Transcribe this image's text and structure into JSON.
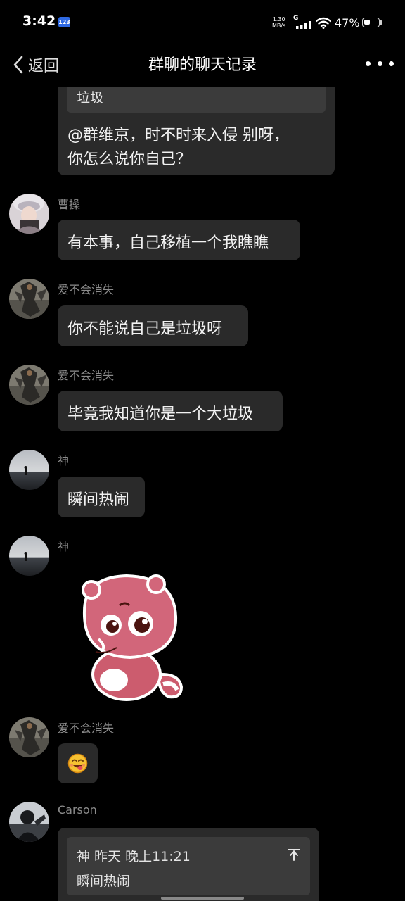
{
  "status_bar": {
    "time": "3:42",
    "keyboard_badge": "123",
    "net_speed_value": "1.30",
    "net_speed_unit": "MB/s",
    "network_gen": "G",
    "battery_percent": "47%",
    "battery_level": 0.47
  },
  "nav": {
    "back_label": "返回",
    "title": "群聊的聊天记录",
    "back_icon": "chevron-left-icon",
    "more_icon": "more-dots-icon"
  },
  "messages": [
    {
      "sender": "",
      "quote": "垃圾",
      "text_lines": [
        "@群维京，时不时来入侵 别呀，",
        "你怎么说你自己？"
      ]
    },
    {
      "sender": "曹操",
      "avatar": "avatar-girl-headdress",
      "text": "有本事，自己移植一个我瞧瞧"
    },
    {
      "sender": "爱不会消失",
      "avatar": "avatar-armored-rider",
      "text": "你不能说自己是垃圾呀"
    },
    {
      "sender": "爱不会消失",
      "avatar": "avatar-armored-rider",
      "text": "毕竟我知道你是一个大垃圾"
    },
    {
      "sender": "神",
      "avatar": "avatar-beach-figure",
      "text": "瞬间热闹"
    },
    {
      "sender": "神",
      "avatar": "avatar-beach-figure",
      "sticker": "pink-bear-sticker"
    },
    {
      "sender": "爱不会消失",
      "avatar": "avatar-armored-rider",
      "emoji": "😋"
    },
    {
      "sender": "Carson",
      "avatar": "avatar-dark-selfie",
      "reply_header": "神 昨天 晚上11:21",
      "reply_text": "瞬间热闹",
      "reply_icon": "jump-to-top-icon"
    }
  ],
  "colors": {
    "background": "#000000",
    "bubble": "#2a2a2a",
    "quote": "#3b3b3b",
    "sender_name": "#8c8c8c"
  }
}
